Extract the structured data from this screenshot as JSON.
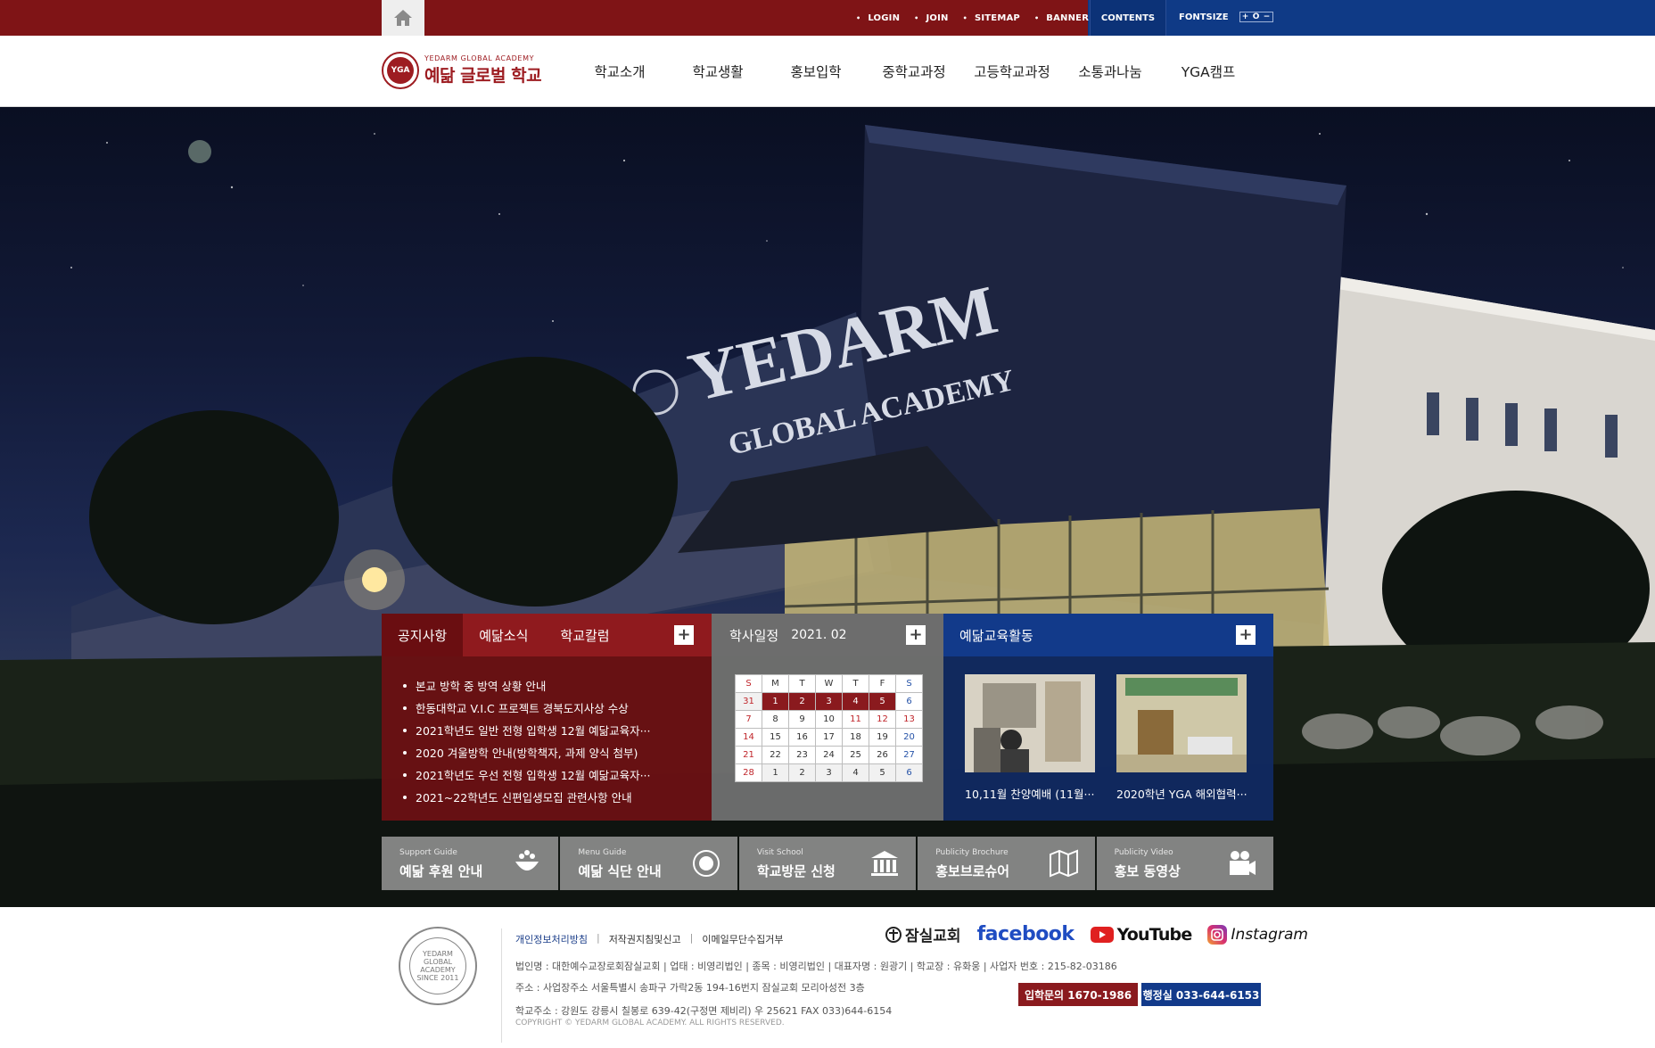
{
  "topbar": {
    "links": [
      {
        "label": "LOGIN"
      },
      {
        "label": "JOIN"
      },
      {
        "label": "SITEMAP"
      },
      {
        "label": "BANNER ZONE"
      }
    ],
    "contents_label": "CONTENTS",
    "fontsize_label": "FONTSIZE",
    "fontsize_controls": [
      "+",
      "O",
      "−"
    ],
    "colors": {
      "red": "#7f1416",
      "blue": "#0f3a86"
    }
  },
  "header": {
    "logo_sub": "YEDARM GLOBAL ACADEMY",
    "logo_main": "예닮 글로벌 학교",
    "logo_seal": "YGA",
    "nav": [
      "학교소개",
      "학교생활",
      "홍보입학",
      "중학교과정",
      "고등학교과정",
      "소통과나눔",
      "YGA캠프"
    ]
  },
  "hero": {
    "sign_line1": "YEDARM",
    "sign_line2": "GLOBAL ACADEMY"
  },
  "notice": {
    "tabs": [
      "공지사항",
      "예닮소식",
      "학교칼럼"
    ],
    "items": [
      "본교 방학 중 방역 상황 안내",
      "한동대학교 V.I.C 프로젝트 경북도지사상 수상",
      "2021학년도 일반 전형 입학생 12월 예닮교육자···",
      "2020 겨울방학 안내(방학책자, 과제 양식 첨부)",
      "2021학년도 우선 전형 입학생 12월 예닮교육자···",
      "2021~22학년도 신편입생모집 관련사항 안내"
    ]
  },
  "calendar": {
    "title": "학사일정",
    "month": "2021. 02",
    "weekdays": [
      "S",
      "M",
      "T",
      "W",
      "T",
      "F",
      "S"
    ],
    "weeks": [
      [
        "31",
        "1",
        "2",
        "3",
        "4",
        "5",
        "6"
      ],
      [
        "7",
        "8",
        "9",
        "10",
        "11",
        "12",
        "13"
      ],
      [
        "14",
        "15",
        "16",
        "17",
        "18",
        "19",
        "20"
      ],
      [
        "21",
        "22",
        "23",
        "24",
        "25",
        "26",
        "27"
      ],
      [
        "28",
        "1",
        "2",
        "3",
        "4",
        "5",
        "6"
      ]
    ],
    "highlighted": [
      "1",
      "2",
      "3",
      "4",
      "5"
    ]
  },
  "activity": {
    "title": "예닮교육활동",
    "items": [
      {
        "caption": "10,11월 찬양예배 (11월···"
      },
      {
        "caption": "2020학년 YGA 해외협력···"
      }
    ]
  },
  "quick_links": [
    {
      "sub": "Support Guide",
      "label": "예닮 후원 안내",
      "icon": "hands-icon"
    },
    {
      "sub": "Menu Guide",
      "label": "예닮 식단 안내",
      "icon": "meal-icon"
    },
    {
      "sub": "Visit School",
      "label": "학교방문 신청",
      "icon": "building-icon"
    },
    {
      "sub": "Publicity Brochure",
      "label": "홍보브로슈어",
      "icon": "brochure-icon"
    },
    {
      "sub": "Publicity Video",
      "label": "홍보 동영상",
      "icon": "video-icon"
    }
  ],
  "footer": {
    "links": [
      "개인정보처리방침",
      "저작권지침및신고",
      "이메일무단수집거부"
    ],
    "info_line1": "법인명 : 대한예수교장로회잠실교회   |   업태 : 비영리법인   |   종목 : 비영리법인   |   대표자명 : 원광기   |   학교장 : 유화웅   |   사업자 번호 : 215-82-03186",
    "info_line2": "주소 : 사업장주소 서울특별시 송파구 가락2동 194-16번지 잠실교회 모리아성전 3층",
    "info_line3": "학교주소 : 강원도 강릉시 칠봉로 639-42(구정면 제비리) 우 25621 FAX 033)644-6154",
    "copyright": "COPYRIGHT © YEDARM GLOBAL ACADEMY. ALL RIGHTS RESERVED.",
    "seal_text": "YEDARM GLOBAL ACADEMY SINCE 2011",
    "sns": {
      "church": "잠실교회",
      "facebook": "facebook",
      "youtube": "YouTube",
      "instagram": "Instagram"
    },
    "contact_admission": "입학문의 1670-1986",
    "contact_office": "행정실 033-644-6153"
  }
}
